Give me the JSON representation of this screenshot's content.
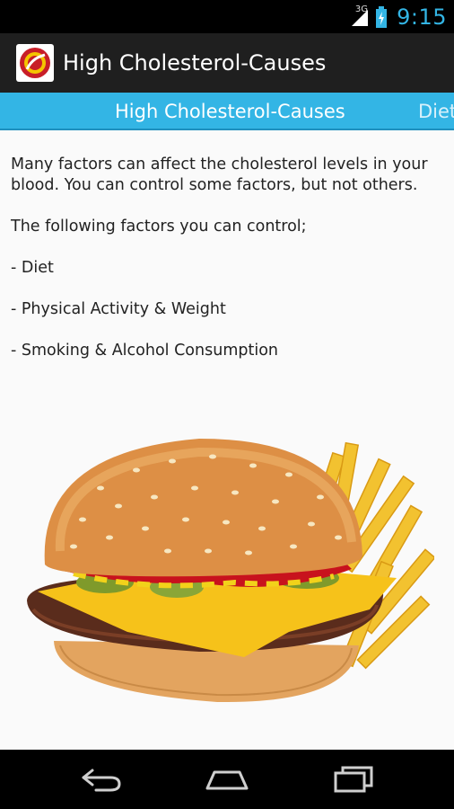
{
  "status_bar": {
    "network": "3G",
    "time": "9:15",
    "signal_icon": "signal-strength-icon",
    "battery_icon": "battery-charging-icon",
    "accent_color": "#33b5e5"
  },
  "action_bar": {
    "title": "High Cholesterol-Causes",
    "app_icon": "heart-logo-icon",
    "background": "#1f1f1f"
  },
  "tabs": [
    {
      "label": "High Cholesterol-Causes",
      "selected": true
    },
    {
      "label": "Diet",
      "selected": false
    }
  ],
  "tab_color": "#33b5e5",
  "content": {
    "intro": "Many factors can affect the cholesterol levels in your blood. You can control some factors, but not others.",
    "control_heading": "The following factors you can control;",
    "items": [
      "- Diet",
      "- Physical Activity & Weight",
      "-  Smoking & Alcohol Consumption"
    ],
    "image": "cheeseburger-with-fries"
  },
  "nav_bar": {
    "back_icon": "back-icon",
    "home_icon": "home-icon",
    "recent_icon": "recent-apps-icon"
  }
}
